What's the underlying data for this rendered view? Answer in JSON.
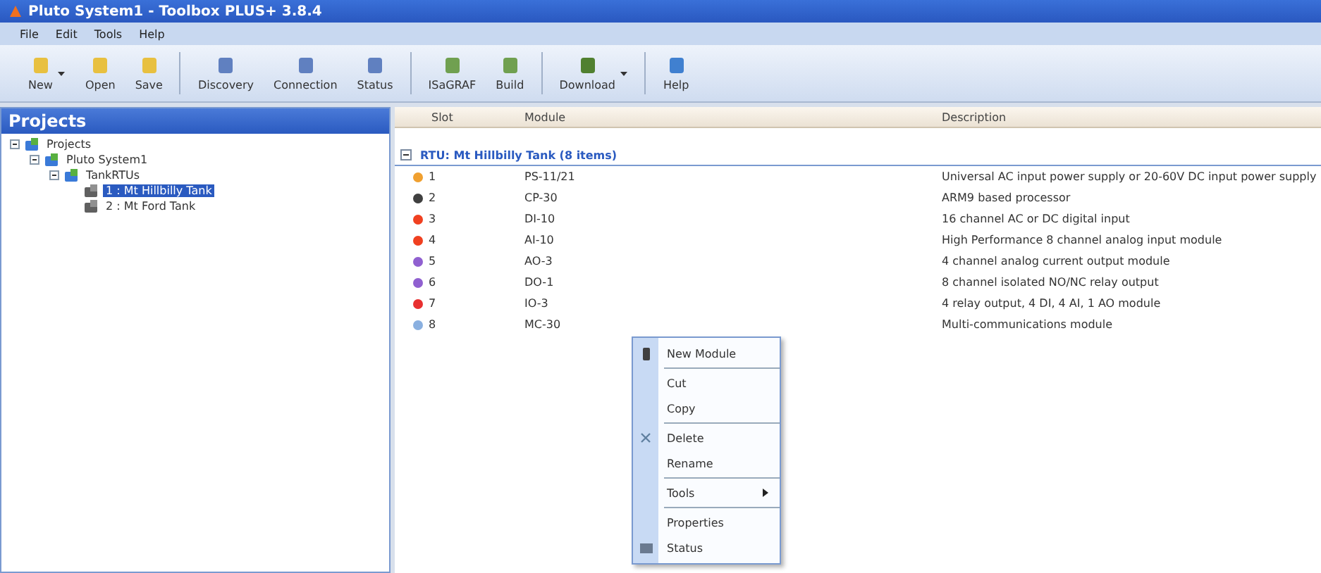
{
  "window": {
    "title": "Pluto System1 - Toolbox PLUS+ 3.8.4"
  },
  "menu": [
    "File",
    "Edit",
    "Tools",
    "Help"
  ],
  "toolbar": [
    [
      {
        "label": "New",
        "dropdown": true
      },
      {
        "label": "Open",
        "dropdown": false
      },
      {
        "label": "Save",
        "dropdown": false
      }
    ],
    [
      {
        "label": "Discovery",
        "dropdown": false
      },
      {
        "label": "Connection",
        "dropdown": false
      },
      {
        "label": "Status",
        "dropdown": false
      }
    ],
    [
      {
        "label": "ISaGRAF",
        "dropdown": false
      },
      {
        "label": "Build",
        "dropdown": false
      }
    ],
    [
      {
        "label": "Download",
        "dropdown": true
      }
    ],
    [
      {
        "label": "Help",
        "dropdown": false
      }
    ]
  ],
  "projects": {
    "title": "Projects",
    "tree": [
      {
        "label": "Projects",
        "expanded": true,
        "selected": false,
        "children": [
          {
            "label": "Pluto System1",
            "expanded": true,
            "selected": false,
            "children": [
              {
                "label": "TankRTUs",
                "expanded": true,
                "selected": false,
                "children": [
                  {
                    "label": "1 : Mt Hillbilly Tank",
                    "selected": true
                  },
                  {
                    "label": "2 : Mt Ford Tank",
                    "selected": false
                  }
                ]
              }
            ]
          }
        ]
      }
    ]
  },
  "table": {
    "columns": [
      "Slot",
      "Module",
      "Description"
    ],
    "group": "RTU: Mt Hillbilly Tank (8 items)",
    "rows": [
      {
        "slot": "1",
        "module": "PS-11/21",
        "description": "Universal AC input power supply or 20-60V DC input power supply",
        "color": "#f0a030"
      },
      {
        "slot": "2",
        "module": "CP-30",
        "description": "ARM9 based processor",
        "color": "#404040"
      },
      {
        "slot": "3",
        "module": "DI-10",
        "description": "16 channel AC or DC digital input",
        "color": "#f04020"
      },
      {
        "slot": "4",
        "module": "AI-10",
        "description": "High Performance 8 channel analog input module",
        "color": "#f04020"
      },
      {
        "slot": "5",
        "module": "AO-3",
        "description": "4 channel analog current output module",
        "color": "#9060d0"
      },
      {
        "slot": "6",
        "module": "DO-1",
        "description": "8 channel isolated NO/NC relay output",
        "color": "#9060d0"
      },
      {
        "slot": "7",
        "module": "IO-3",
        "description": "4 relay output, 4 DI, 4 AI, 1 AO module",
        "color": "#e83030"
      },
      {
        "slot": "8",
        "module": "MC-30",
        "description": "Multi-communications module",
        "color": "#8ab0e0"
      }
    ]
  },
  "context_menu": [
    [
      {
        "label": "New Module",
        "submenu": false
      }
    ],
    [
      {
        "label": "Cut",
        "submenu": false
      },
      {
        "label": "Copy",
        "submenu": false
      }
    ],
    [
      {
        "label": "Delete",
        "submenu": false
      },
      {
        "label": "Rename",
        "submenu": false
      }
    ],
    [
      {
        "label": "Tools",
        "submenu": true
      }
    ],
    [
      {
        "label": "Properties",
        "submenu": false
      },
      {
        "label": "Status",
        "submenu": false
      }
    ]
  ]
}
